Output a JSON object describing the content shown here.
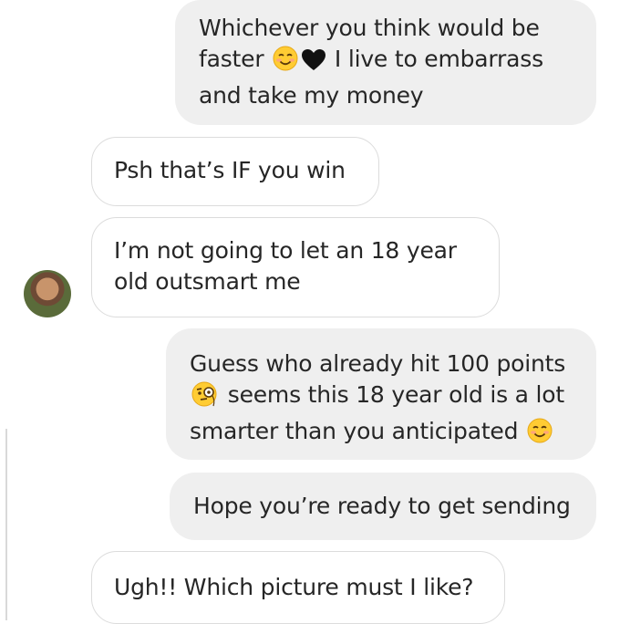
{
  "conversation": {
    "messages": [
      {
        "sender": "me",
        "lines": [
          "Whichever you think would be",
          "faster",
          "I live to embarrass",
          "and take my money"
        ],
        "emojis": [
          "smiling-face-icon",
          "black-heart-icon"
        ]
      },
      {
        "sender": "them",
        "lines": [
          "Psh that’s IF you win"
        ]
      },
      {
        "sender": "them",
        "lines": [
          "I’m not going to let an 18 year",
          "old outsmart me"
        ]
      },
      {
        "sender": "me",
        "lines": [
          "Guess who already hit 100 points",
          "seems this 18 year old is a lot",
          "smarter than you anticipated"
        ],
        "emojis": [
          "monocle-face-icon",
          "smiling-face-icon"
        ]
      },
      {
        "sender": "me",
        "lines": [
          "Hope you’re ready to get sending"
        ]
      },
      {
        "sender": "them",
        "lines": [
          "Ugh!! Which picture must I like?"
        ]
      }
    ]
  },
  "colors": {
    "outgoing_bubble": "#efefef",
    "incoming_border": "#dcdcdc",
    "text": "#262626"
  }
}
